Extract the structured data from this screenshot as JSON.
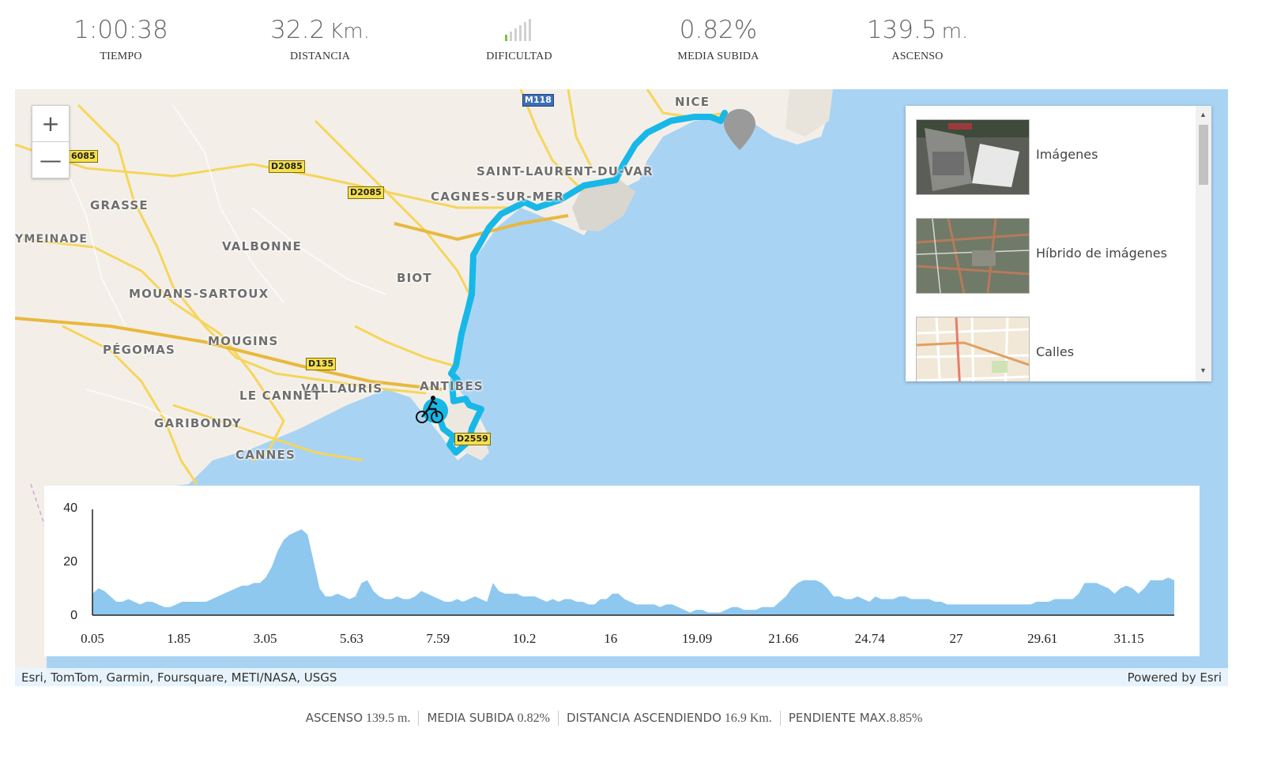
{
  "stats": [
    {
      "value": "1:00:38",
      "unit": "",
      "label": "TIEMPO"
    },
    {
      "value": "32.2",
      "unit": "Km.",
      "label": "DISTANCIA"
    },
    {
      "value": "",
      "unit": "",
      "label": "DIFICULTAD",
      "difficulty_level": 1,
      "difficulty_max": 6
    },
    {
      "value": "0.82%",
      "unit": "",
      "label": "MEDIA SUBIDA"
    },
    {
      "value": "139.5",
      "unit": "m.",
      "label": "ASCENSO"
    }
  ],
  "colors": {
    "route": "#17b8e8",
    "profile_fill": "#8ec8ef",
    "water": "#a9d3f3",
    "land": "#f2efe9",
    "difficulty_on": "#7cc242",
    "difficulty_off": "#d0d0d0"
  },
  "map": {
    "zoom_in": "+",
    "zoom_out": "—",
    "places": [
      "NICE",
      "SAINT-LAURENT-DU-VAR",
      "CAGNES-SUR-MER",
      "GRASSE",
      "YMEINADE",
      "VALBONNE",
      "BIOT",
      "MOUANS-SARTOUX",
      "MOUGINS",
      "PÉGOMAS",
      "ANTIBES",
      "VALLAURIS",
      "LE CANNET",
      "GARIBONDY",
      "CANNES"
    ],
    "roads": [
      "M118",
      "D2085",
      "D2085",
      "D2085",
      "6085",
      "D135",
      "D2559"
    ],
    "icons": {
      "zoom_in": "plus-icon",
      "zoom_out": "minus-icon",
      "end": "map-pin-icon",
      "start": "cyclist-icon"
    },
    "gallery": [
      {
        "label": "Imágenes"
      },
      {
        "label": "Híbrido de imágenes"
      },
      {
        "label": "Calles"
      }
    ],
    "attribution": "Esri, TomTom, Garmin, Foursquare, METI/NASA, USGS",
    "powered_by": "Powered by Esri"
  },
  "chart_data": {
    "type": "area",
    "title": "",
    "xlabel": "",
    "ylabel": "",
    "x_tick_labels": [
      "0.05",
      "1.85",
      "3.05",
      "5.63",
      "7.59",
      "10.2",
      "16",
      "19.09",
      "21.66",
      "24.74",
      "27",
      "29.61",
      "31.15"
    ],
    "y_ticks": [
      0,
      20,
      40
    ],
    "ylim": [
      0,
      40
    ],
    "grid": false,
    "series": [
      {
        "values": [
          8,
          10,
          9,
          7,
          5,
          5,
          6,
          5,
          4,
          5,
          5,
          4,
          3,
          3,
          4,
          5,
          5,
          5,
          5,
          5,
          6,
          7,
          8,
          9,
          10,
          11,
          11,
          12,
          12,
          14,
          18,
          24,
          28,
          30,
          31,
          32,
          30,
          20,
          10,
          7,
          7,
          8,
          7,
          6,
          7,
          12,
          13,
          9,
          7,
          6,
          6,
          7,
          6,
          6,
          7,
          9,
          8,
          7,
          6,
          5,
          5,
          6,
          5,
          6,
          7,
          6,
          5,
          12,
          9,
          8,
          8,
          8,
          7,
          7,
          7,
          6,
          5,
          6,
          5,
          6,
          6,
          5,
          5,
          4,
          4,
          6,
          6,
          8,
          8,
          6,
          5,
          4,
          4,
          4,
          4,
          3,
          4,
          4,
          3,
          2,
          1,
          2,
          2,
          1,
          1,
          1,
          2,
          3,
          3,
          2,
          2,
          2,
          3,
          3,
          3,
          5,
          7,
          10,
          12,
          13,
          13,
          13,
          12,
          10,
          7,
          7,
          6,
          6,
          7,
          6,
          5,
          7,
          6,
          6,
          6,
          7,
          7,
          6,
          6,
          6,
          6,
          5,
          5,
          4,
          4,
          4,
          4,
          4,
          4,
          4,
          4,
          4,
          4,
          4,
          4,
          4,
          4,
          4,
          5,
          5,
          5,
          6,
          6,
          6,
          6,
          8,
          12,
          12,
          12,
          11,
          10,
          8,
          10,
          11,
          10,
          8,
          10,
          13,
          13,
          13,
          14,
          13
        ]
      }
    ]
  },
  "summary": [
    {
      "label": "ASCENSO",
      "value": "139.5 m."
    },
    {
      "label": "MEDIA SUBIDA",
      "value": "0.82%"
    },
    {
      "label": "DISTANCIA ASCENDIENDO",
      "value": "16.9 Km."
    },
    {
      "label": "PENDIENTE MAX.",
      "value": "8.85%"
    }
  ]
}
